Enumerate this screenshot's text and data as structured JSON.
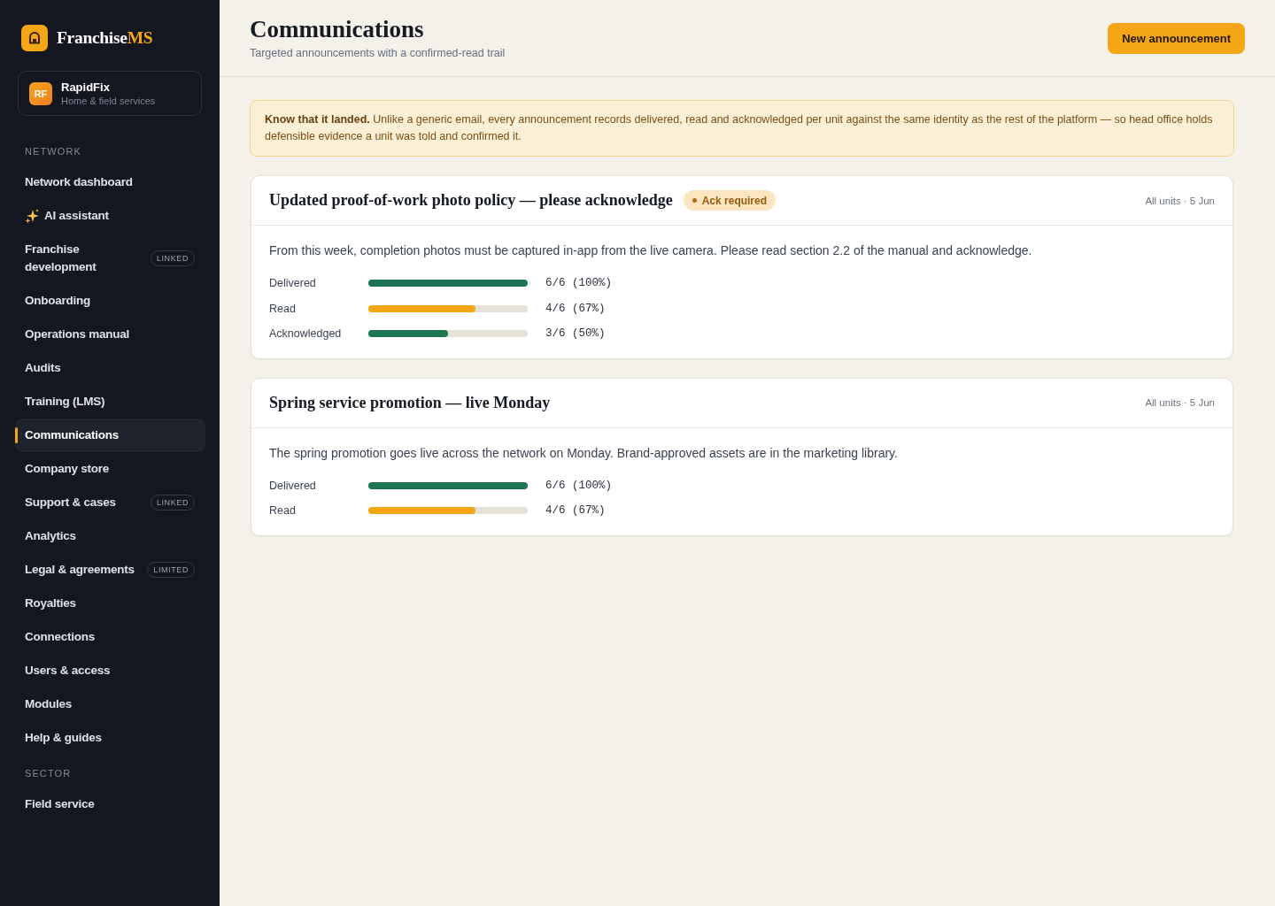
{
  "brand": {
    "name": "Franchise",
    "accent": "MS"
  },
  "org": {
    "initials": "RF",
    "name": "RapidFix",
    "subtitle": "Home & field services"
  },
  "sidebar": {
    "sections": [
      {
        "title": "NETWORK",
        "items": [
          {
            "label": "Network dashboard",
            "kind": "link",
            "selected": false
          },
          {
            "label": "AI assistant",
            "kind": "assistant",
            "selected": false
          },
          {
            "label": "Franchise development",
            "kind": "link",
            "selected": false,
            "badge": "LINKED"
          },
          {
            "label": "Onboarding",
            "kind": "link",
            "selected": false
          },
          {
            "label": "Operations manual",
            "kind": "link",
            "selected": false
          },
          {
            "label": "Audits",
            "kind": "link",
            "selected": false
          },
          {
            "label": "Training (LMS)",
            "kind": "link",
            "selected": false
          },
          {
            "label": "Communications",
            "kind": "link",
            "selected": true
          },
          {
            "label": "Company store",
            "kind": "link",
            "selected": false
          },
          {
            "label": "Support & cases",
            "kind": "link",
            "selected": false,
            "badge": "LINKED"
          },
          {
            "label": "Analytics",
            "kind": "link",
            "selected": false
          },
          {
            "label": "Legal & agreements",
            "kind": "link",
            "selected": false,
            "badge": "LIMITED"
          },
          {
            "label": "Royalties",
            "kind": "link",
            "selected": false
          },
          {
            "label": "Connections",
            "kind": "link",
            "selected": false
          },
          {
            "label": "Users & access",
            "kind": "link",
            "selected": false
          },
          {
            "label": "Modules",
            "kind": "link",
            "selected": false
          },
          {
            "label": "Help & guides",
            "kind": "link",
            "selected": false
          }
        ]
      },
      {
        "title": "SECTOR",
        "items": [
          {
            "label": "Field service",
            "kind": "link",
            "selected": false
          }
        ]
      }
    ]
  },
  "header": {
    "title": "Communications",
    "subtitle": "Targeted announcements with a confirmed-read trail",
    "action": "New announcement"
  },
  "notice": {
    "text": "**Know that it landed.** Unlike a generic email, every announcement records delivered, read and acknowledged per unit against the same identity as the rest of the platform — so head office holds defensible evidence a unit was told and confirmed it."
  },
  "announcements": [
    {
      "title": "Updated proof-of-work photo policy — please acknowledge",
      "badge": "Ack required",
      "meta": "All units · 5 Jun",
      "body": "From this week, completion photos must be captured in-app from the live camera. Please read section 2.2 of the manual and acknowledge.",
      "metrics": [
        {
          "label": "Delivered",
          "level": 1,
          "reading": "6/6 (100%)",
          "color": "#1e7553"
        },
        {
          "label": "Read",
          "level": 0.67,
          "reading": "4/6 (67%)",
          "color": "#f5a617"
        },
        {
          "label": "Acknowledged",
          "level": 0.5,
          "reading": "3/6 (50%)",
          "color": "#1e7553"
        }
      ]
    },
    {
      "title": "Spring service promotion — live Monday",
      "meta": "All units · 5 Jun",
      "body": "The spring promotion goes live across the network on Monday. Brand-approved assets are in the marketing library.",
      "metrics": [
        {
          "label": "Delivered",
          "level": 1,
          "reading": "6/6 (100%)",
          "color": "#1e7553"
        },
        {
          "label": "Read",
          "level": 0.67,
          "reading": "4/6 (67%)",
          "color": "#f5a617"
        }
      ]
    }
  ]
}
